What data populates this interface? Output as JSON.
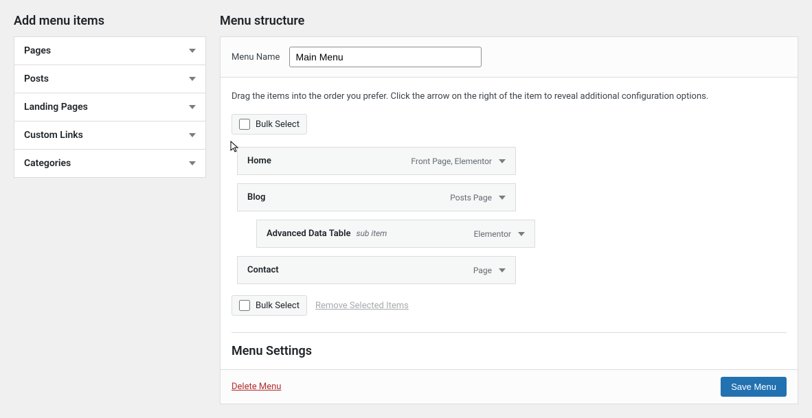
{
  "left": {
    "heading": "Add menu items",
    "items": [
      "Pages",
      "Posts",
      "Landing Pages",
      "Custom Links",
      "Categories"
    ]
  },
  "right": {
    "heading": "Menu structure",
    "menuNameLabel": "Menu Name",
    "menuNameValue": "Main Menu",
    "instructions": "Drag the items into the order you prefer. Click the arrow on the right of the item to reveal additional configuration options.",
    "bulkSelectLabel": "Bulk Select",
    "removeSelectedLabel": "Remove Selected Items",
    "items": [
      {
        "title": "Home",
        "type": "Front Page, Elementor",
        "sub": false,
        "subLabel": ""
      },
      {
        "title": "Blog",
        "type": "Posts Page",
        "sub": false,
        "subLabel": ""
      },
      {
        "title": "Advanced Data Table",
        "type": "Elementor",
        "sub": true,
        "subLabel": "sub item"
      },
      {
        "title": "Contact",
        "type": "Page",
        "sub": false,
        "subLabel": ""
      }
    ],
    "settingsHeading": "Menu Settings",
    "deleteLabel": "Delete Menu",
    "saveLabel": "Save Menu"
  }
}
